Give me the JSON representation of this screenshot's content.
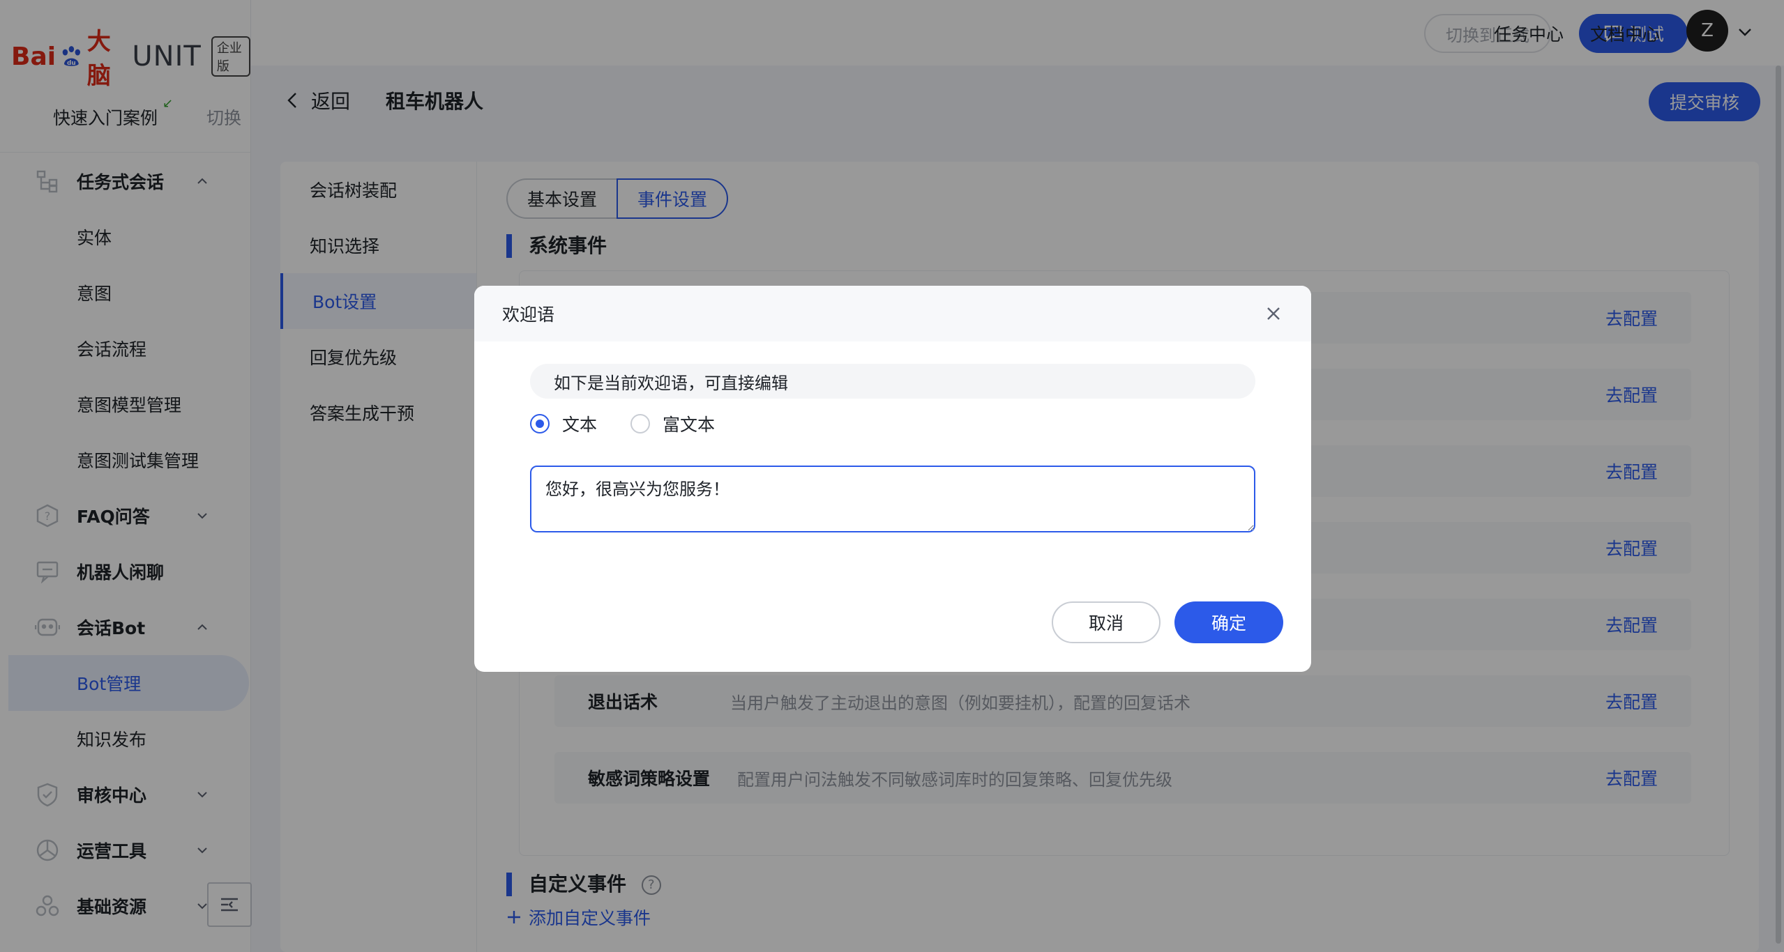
{
  "logo": {
    "bai": "Bai",
    "du": "du",
    "danao": "大脑",
    "unit": "UNIT",
    "badge": "企业版"
  },
  "sidebar": {
    "project_name": "快速入门案例",
    "switch_label": "切换",
    "items": [
      {
        "label": "任务式会话",
        "type": "group",
        "icon": "tree-icon",
        "expanded": true
      },
      {
        "label": "实体",
        "type": "sub"
      },
      {
        "label": "意图",
        "type": "sub"
      },
      {
        "label": "会话流程",
        "type": "sub"
      },
      {
        "label": "意图模型管理",
        "type": "sub"
      },
      {
        "label": "意图测试集管理",
        "type": "sub"
      },
      {
        "label": "FAQ问答",
        "type": "group",
        "icon": "faq-icon",
        "expanded": false
      },
      {
        "label": "机器人闲聊",
        "type": "group",
        "icon": "chat-icon"
      },
      {
        "label": "会话Bot",
        "type": "group",
        "icon": "bot-icon",
        "expanded": true
      },
      {
        "label": "Bot管理",
        "type": "sub",
        "active": true
      },
      {
        "label": "知识发布",
        "type": "sub"
      },
      {
        "label": "审核中心",
        "type": "group",
        "icon": "shield-icon",
        "expanded": false
      },
      {
        "label": "运营工具",
        "type": "group",
        "icon": "pie-icon",
        "expanded": false
      },
      {
        "label": "基础资源",
        "type": "group",
        "icon": "cubes-icon",
        "expanded": false
      }
    ]
  },
  "topbar": {
    "switch_formal": "切换到正式",
    "test_button": "测试",
    "task_center": "任务中心",
    "doc_center": "文档中心",
    "avatar_initial": "Z"
  },
  "header": {
    "back_label": "返回",
    "title": "租车机器人",
    "submit_label": "提交审核"
  },
  "subnav": {
    "items": [
      "会话树装配",
      "知识选择",
      "Bot设置",
      "回复优先级",
      "答案生成干预"
    ],
    "active_index": 2
  },
  "tabs": {
    "basic": "基本设置",
    "events": "事件设置"
  },
  "system_events": {
    "title": "系统事件",
    "configure_label": "去配置",
    "rows": [
      {
        "name": "",
        "desc": ""
      },
      {
        "name": "",
        "desc": ""
      },
      {
        "name": "",
        "desc": ""
      },
      {
        "name": "",
        "desc": ""
      },
      {
        "name": "",
        "desc": ""
      },
      {
        "name": "退出话术",
        "desc": "当用户触发了主动退出的意图（例如要挂机），配置的回复话术"
      },
      {
        "name": "敏感词策略设置",
        "desc": "配置用户问法触发不同敏感词库时的回复策略、回复优先级"
      }
    ]
  },
  "custom_events": {
    "title": "自定义事件",
    "help": "?",
    "add_label": "添加自定义事件"
  },
  "modal": {
    "title": "欢迎语",
    "notice": "如下是当前欢迎语，可直接编辑",
    "radio_text": "文本",
    "radio_rich": "富文本",
    "textarea_value": "您好，很高兴为您服务！",
    "cancel": "取消",
    "ok": "确定"
  },
  "colors": {
    "accent": "#2c5ae9",
    "overlay": "rgba(0,0,0,0.4)"
  }
}
